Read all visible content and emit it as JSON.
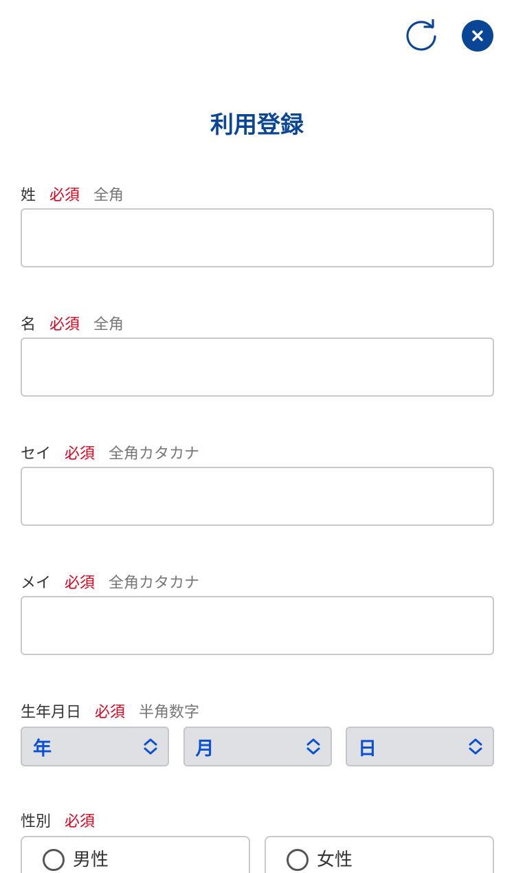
{
  "header": {
    "title": "利用登録",
    "reload_icon": "reload-icon",
    "close_icon": "close-icon",
    "accent_color": "#0a4696"
  },
  "fields": [
    {
      "label": "姓",
      "required": "必須",
      "hint": "全角",
      "value": "",
      "placeholder": ""
    },
    {
      "label": "名",
      "required": "必須",
      "hint": "全角",
      "value": "",
      "placeholder": ""
    },
    {
      "label": "セイ",
      "required": "必須",
      "hint": "全角カタカナ",
      "value": "",
      "placeholder": ""
    },
    {
      "label": "メイ",
      "required": "必須",
      "hint": "全角カタカナ",
      "value": "",
      "placeholder": ""
    }
  ],
  "birthday": {
    "label": "生年月日",
    "required": "必須",
    "hint": "半角数字",
    "selects": [
      {
        "label": "年"
      },
      {
        "label": "月"
      },
      {
        "label": "日"
      }
    ]
  },
  "gender": {
    "label": "性別",
    "required": "必須",
    "options": [
      {
        "label": "男性",
        "selected": false
      },
      {
        "label": "女性",
        "selected": false
      }
    ]
  },
  "colors": {
    "required": "#e0001b",
    "select_text": "#0a4fd4"
  }
}
